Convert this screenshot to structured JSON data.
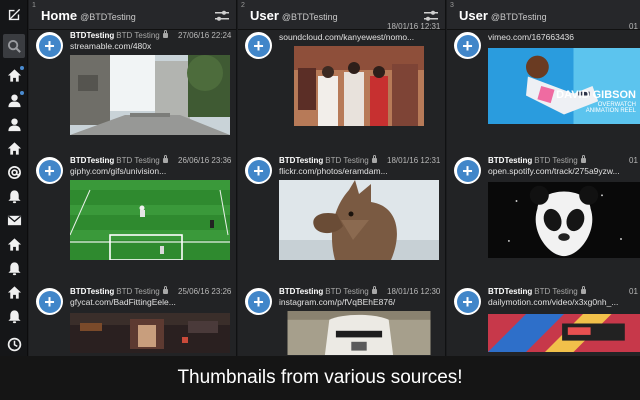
{
  "nav": {
    "items": [
      {
        "icon": "search-icon"
      },
      {
        "icon": "home-icon",
        "dot": true
      },
      {
        "icon": "user-icon",
        "dot": true
      },
      {
        "icon": "user-icon"
      },
      {
        "icon": "home-icon"
      },
      {
        "icon": "mention-icon"
      },
      {
        "icon": "bell-icon"
      },
      {
        "icon": "message-icon"
      },
      {
        "icon": "home-icon"
      },
      {
        "icon": "bell-icon"
      },
      {
        "icon": "home-icon"
      },
      {
        "icon": "bell-icon"
      },
      {
        "icon": "clock-icon"
      }
    ]
  },
  "columns": [
    {
      "number": "1",
      "title": "Home",
      "subtitle": "@BTDTesting",
      "tweets": [
        {
          "name": "BTDTesting",
          "handle": "BTD Testing",
          "time": "27/06/16 22:24",
          "link": "streamable.com/480x",
          "thumb": "street"
        },
        {
          "name": "BTDTesting",
          "handle": "BTD Testing",
          "time": "26/06/16 23:36",
          "link": "giphy.com/gifs/univision...",
          "thumb": "soccer"
        },
        {
          "name": "BTDTesting",
          "handle": "BTD Testing",
          "time": "25/06/16 23:26",
          "link": "gfycat.com/BadFittingEele...",
          "thumb": "game"
        }
      ]
    },
    {
      "number": "2",
      "title": "User",
      "subtitle": "@BTDTesting",
      "tweets": [
        {
          "name": "",
          "handle": "",
          "time": "18/01/16 12:31",
          "link": "soundcloud.com/kanyewest/nomo...",
          "thumb": "people"
        },
        {
          "name": "BTDTesting",
          "handle": "BTD Testing",
          "time": "18/01/16 12:31",
          "link": "flickr.com/photos/eramdam...",
          "thumb": "llama"
        },
        {
          "name": "BTDTesting",
          "handle": "BTD Testing",
          "time": "18/01/16 12:30",
          "link": "instagram.com/p/fVqBEhE876/",
          "thumb": "trooper"
        }
      ]
    },
    {
      "number": "3",
      "title": "User",
      "subtitle": "@BTDTesting",
      "tweets": [
        {
          "name": "",
          "handle": "",
          "time": "01",
          "link": "vimeo.com/167663436",
          "thumb": "dva",
          "overlay": [
            "DAVID GIBSON",
            "OVERWATCH",
            "ANIMATION REEL"
          ]
        },
        {
          "name": "BTDTesting",
          "handle": "BTD Testing",
          "time": "01",
          "link": "open.spotify.com/track/275a9yzw...",
          "thumb": "panda"
        },
        {
          "name": "BTDTesting",
          "handle": "BTD Testing",
          "time": "01",
          "link": "dailymotion.com/video/x3xg0nh_...",
          "thumb": "vhs"
        }
      ]
    }
  ],
  "caption": "Thumbnails from various sources!"
}
